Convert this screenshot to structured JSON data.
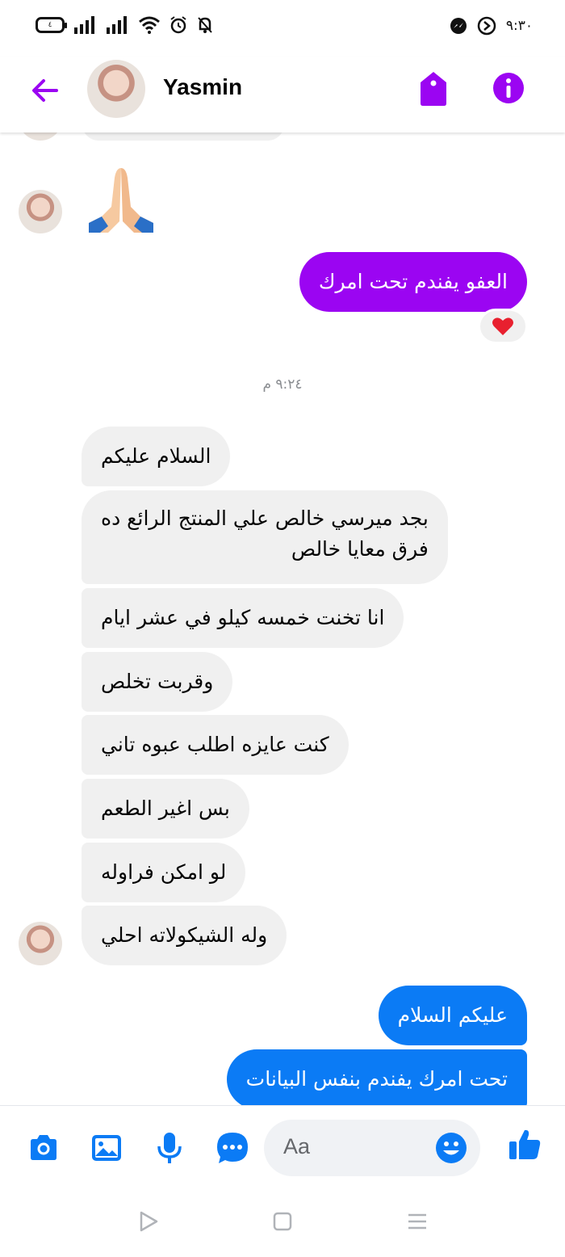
{
  "status_bar": {
    "battery": "٤",
    "time": "٩:٣٠"
  },
  "header": {
    "contact_name": "Yasmin"
  },
  "messages": {
    "sent_purple": "العفو يفندم تحت امرك",
    "reaction": "❤️",
    "timestamp": "٩:٢٤ م",
    "received": [
      "السلام عليكم",
      "بجد ميرسي خالص علي المنتج الرائع ده",
      "فرق معايا خالص",
      "انا تخنت خمسه كيلو في عشر ايام",
      "وقربت تخلص",
      "كنت عايزه اطلب عبوه تاني",
      "بس اغير الطعم",
      "لو امكن فراوله",
      "وله الشيكولاته احلي"
    ],
    "sent_blue": [
      "عليكم السلام",
      "تحت امرك يفندم بنفس البيانات"
    ]
  },
  "composer": {
    "placeholder": "Aa"
  },
  "colors": {
    "accent_purple": "#9b05f2",
    "accent_blue": "#0b7bf5",
    "bubble_gray": "#f0f0f0"
  },
  "icons": [
    "back-arrow-icon",
    "tag-icon",
    "info-icon",
    "camera-icon",
    "gallery-icon",
    "microphone-icon",
    "chat-extensions-icon",
    "emoji-icon",
    "like-icon"
  ]
}
